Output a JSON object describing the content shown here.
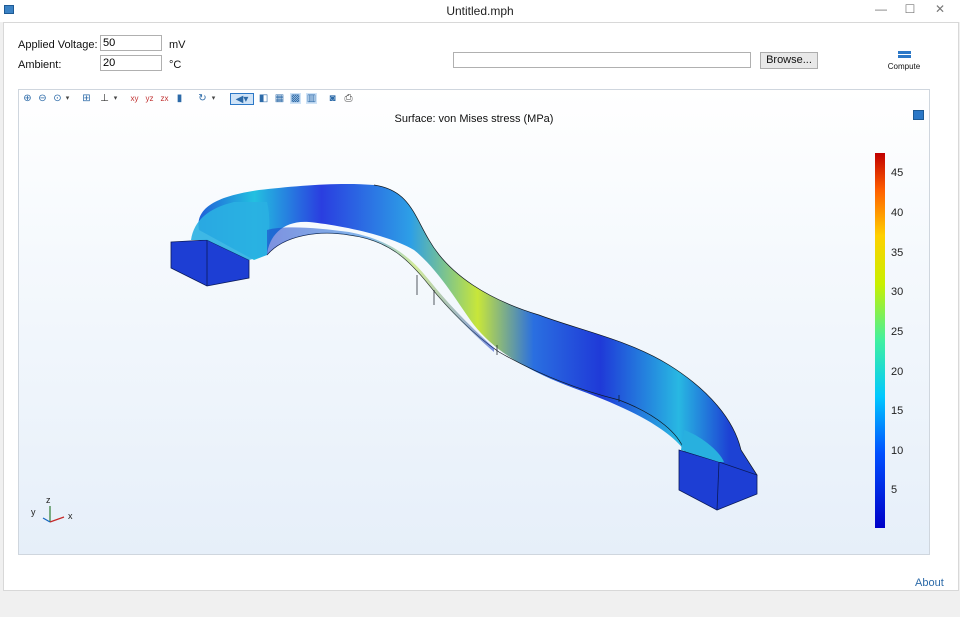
{
  "window": {
    "title": "Untitled.mph",
    "minimize": "—",
    "maximize": "☐",
    "close": "✕"
  },
  "form": {
    "voltage_label": "Applied Voltage:",
    "voltage_value": "50",
    "voltage_unit": "mV",
    "ambient_label": "Ambient:",
    "ambient_value": "20",
    "ambient_unit": "°C",
    "path_value": "",
    "browse_label": "Browse...",
    "compute_label": "Compute"
  },
  "toolbar": {
    "icons": [
      "zoom-in-icon",
      "zoom-out-icon",
      "zoom-box-icon",
      "zoom-extents-icon",
      "axis-orientation-icon",
      "view-xy-icon",
      "view-yz-icon",
      "view-zx-icon",
      "go-to-view-icon",
      "rotate-icon",
      "scene-light-icon",
      "transparency-icon",
      "wireframe-icon",
      "grid-icon",
      "render-icon",
      "camera-icon",
      "print-icon"
    ]
  },
  "plot": {
    "title": "Surface: von Mises stress (MPa)",
    "colorbar_ticks": [
      "45",
      "40",
      "35",
      "30",
      "25",
      "20",
      "15",
      "10",
      "5"
    ],
    "axes": {
      "x": "x",
      "y": "y",
      "z": "z"
    }
  },
  "colors": {
    "accent": "#2c78c7",
    "link": "#2c6aa8"
  },
  "footer": {
    "about": "About"
  }
}
